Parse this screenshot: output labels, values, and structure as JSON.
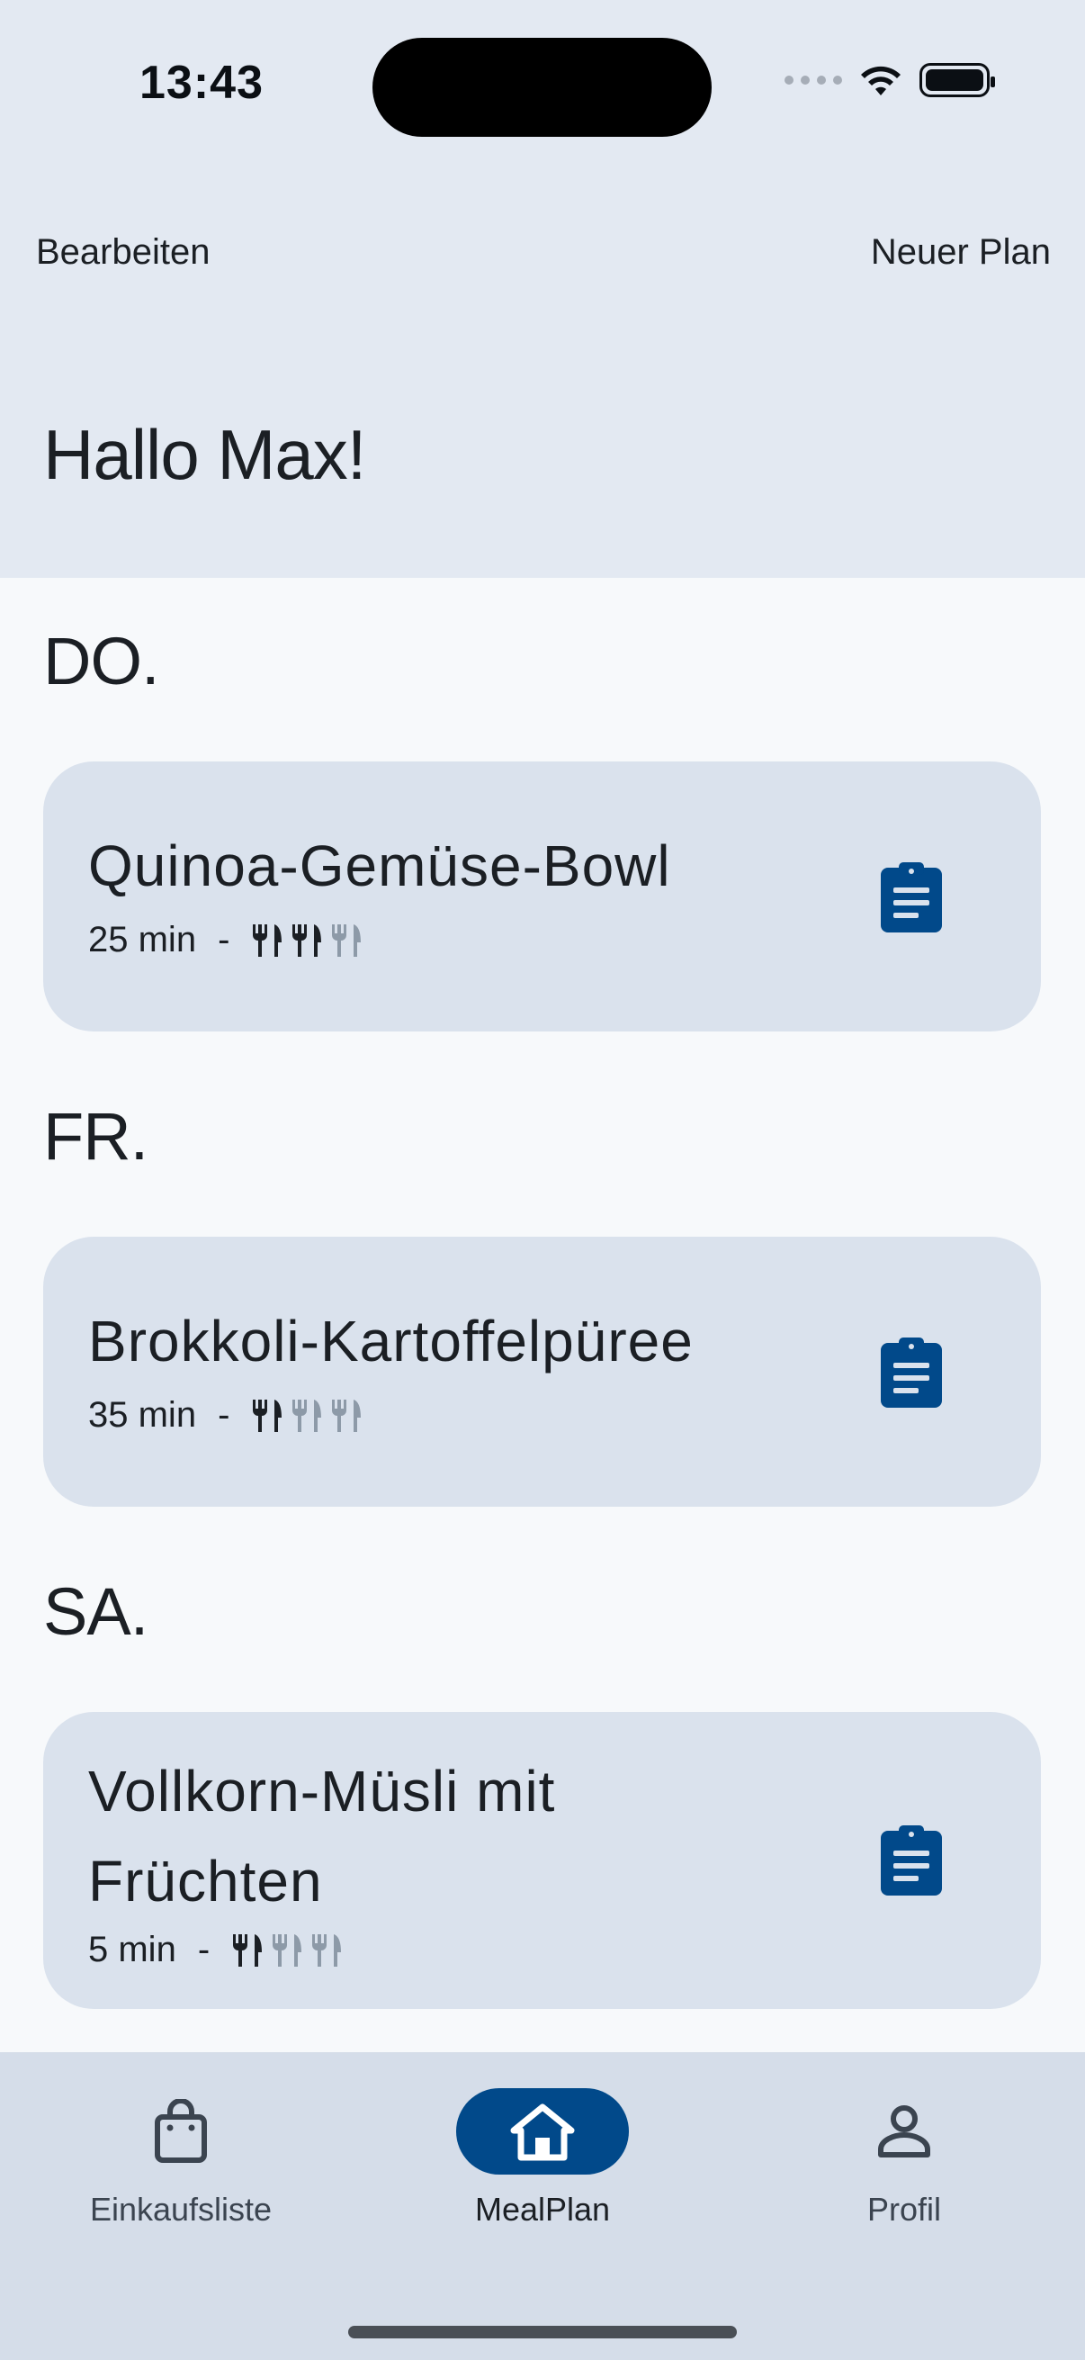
{
  "status_bar": {
    "time": "13:43",
    "icons": [
      "cellular-signal-icon",
      "wifi-icon",
      "battery-icon"
    ]
  },
  "header": {
    "edit_label": "Bearbeiten",
    "new_plan_label": "Neuer Plan",
    "greeting": "Hallo Max!"
  },
  "days": [
    {
      "label": "DO.",
      "meal": {
        "title": "Quinoa-Gemüse-Bowl",
        "time": "25 min",
        "separator": "-",
        "difficulty": 2,
        "difficulty_max": 3
      }
    },
    {
      "label": "FR.",
      "meal": {
        "title": "Brokkoli-Kartoffelpüree",
        "time": "35 min",
        "separator": "-",
        "difficulty": 1,
        "difficulty_max": 3
      }
    },
    {
      "label": "SA.",
      "meal": {
        "title": "Vollkorn-Müsli mit Früchten",
        "time": "5 min",
        "separator": "-",
        "difficulty": 1,
        "difficulty_max": 3
      }
    }
  ],
  "bottom_nav": {
    "items": [
      {
        "label": "Einkaufsliste",
        "icon": "shopping-bag-icon",
        "active": false
      },
      {
        "label": "MealPlan",
        "icon": "home-icon",
        "active": true
      },
      {
        "label": "Profil",
        "icon": "person-icon",
        "active": false
      }
    ]
  },
  "colors": {
    "header_bg": "#e3e9f2",
    "content_bg": "#f7f9fb",
    "card_bg": "#dae2ed",
    "accent": "#01498a",
    "difficulty_active": "#1b1f24",
    "difficulty_inactive": "#8d9aa8"
  }
}
